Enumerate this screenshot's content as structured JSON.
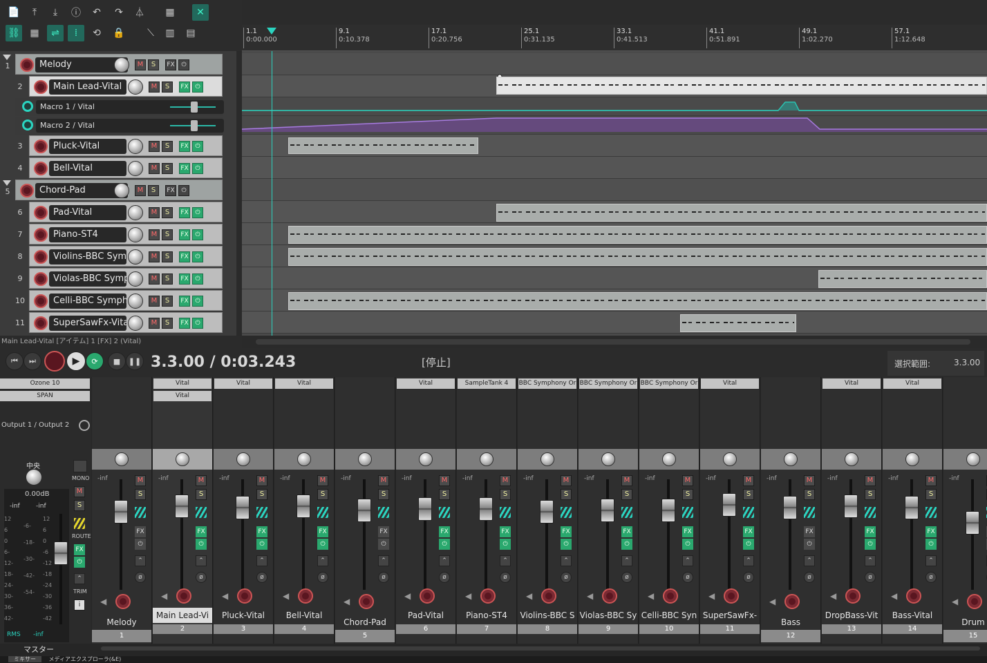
{
  "toolbar": {
    "row1_icons": [
      "new-file-icon",
      "open-icon",
      "save-icon",
      "info-icon",
      "undo-icon",
      "redo-icon",
      "metronome-icon",
      "grid-toggle-icon",
      "snap-icon"
    ],
    "row2_icons": [
      "link-icon",
      "grid-icon",
      "ripple-icon",
      "grid-lines-icon",
      "loop-icon",
      "lock-icon",
      "auto-crossfade-icon",
      "piano-icon",
      "piano-roll-icon"
    ]
  },
  "ruler": {
    "marks": [
      {
        "bar": "1.1",
        "time": "0:00.000"
      },
      {
        "bar": "9.1",
        "time": "0:10.378"
      },
      {
        "bar": "17.1",
        "time": "0:20.756"
      },
      {
        "bar": "25.1",
        "time": "0:31.135"
      },
      {
        "bar": "33.1",
        "time": "0:41.513"
      },
      {
        "bar": "41.1",
        "time": "0:51.891"
      },
      {
        "bar": "49.1",
        "time": "1:02.270"
      },
      {
        "bar": "57.1",
        "time": "1:12.648"
      }
    ]
  },
  "tracks": [
    {
      "num": "1",
      "name": "Melody",
      "folder": true,
      "fx": "FX"
    },
    {
      "num": "2",
      "name": "Main Lead-Vital",
      "selected": true,
      "fx": "FX"
    },
    {
      "num": "3",
      "name": "Pluck-Vital",
      "fx": "FX"
    },
    {
      "num": "4",
      "name": "Bell-Vital",
      "fx": "FX"
    },
    {
      "num": "5",
      "name": "Chord-Pad",
      "folder": true,
      "fx": "FX"
    },
    {
      "num": "6",
      "name": "Pad-Vital",
      "fx": "FX"
    },
    {
      "num": "7",
      "name": "Piano-ST4",
      "fx": "FX"
    },
    {
      "num": "8",
      "name": "Violins-BBC Symp",
      "fx": "FX"
    },
    {
      "num": "9",
      "name": "Violas-BBC Sympl",
      "fx": "FX"
    },
    {
      "num": "10",
      "name": "Celli-BBC Sympho",
      "fx": "FX"
    },
    {
      "num": "11",
      "name": "SuperSawFx-Vita",
      "fx": "FX"
    }
  ],
  "envelopes": [
    {
      "name": "Macro 1 / Vital"
    },
    {
      "name": "Macro 2 / Vital"
    }
  ],
  "labels": {
    "mute": "M",
    "solo": "S"
  },
  "status_line": "Main Lead-Vital [アイテム] 1 [FX] 2 (Vital)",
  "transport": {
    "time": "3.3.00 / 0:03.243",
    "state": "[停止]",
    "selection_label": "選択範囲:",
    "selection_value": "3.3.00"
  },
  "master": {
    "fx1": "Ozone 10",
    "fx2": "SPAN",
    "output": "Output 1 / Output 2",
    "pan_label": "中央",
    "db": "0.00dB",
    "inf_l": "-inf",
    "inf_r": "-inf",
    "scale_l": [
      "12",
      "6",
      "0",
      "6-",
      "12-",
      "18-",
      "24-",
      "30-",
      "36-",
      "42-"
    ],
    "scale_mid": [
      "-6-",
      "-18-",
      "-30-",
      "-42-",
      "-54-"
    ],
    "scale_r": [
      "12",
      "6",
      "0",
      "-6",
      "-12",
      "-18",
      "-24",
      "-30",
      "-36",
      "-42"
    ],
    "rms": "RMS",
    "rms_val": "-inf",
    "name": "マスター",
    "side_labels": {
      "mono": "MONO",
      "route": "ROUTE",
      "trim": "TRIM"
    }
  },
  "mixer_strips": [
    {
      "name": "Melody",
      "num": "1",
      "fx": [],
      "folder": true,
      "fxon": false
    },
    {
      "name": "Main Lead-Vi",
      "num": "2",
      "fx": [
        "Vital",
        "Vital"
      ],
      "selected": true,
      "fxon": true
    },
    {
      "name": "Pluck-Vital",
      "num": "3",
      "fx": [
        "Vital"
      ],
      "fxon": true
    },
    {
      "name": "Bell-Vital",
      "num": "4",
      "fx": [
        "Vital"
      ],
      "fxon": true
    },
    {
      "name": "Chord-Pad",
      "num": "5",
      "fx": [],
      "folder": true,
      "fxon": false
    },
    {
      "name": "Pad-Vital",
      "num": "6",
      "fx": [
        "Vital"
      ],
      "fxon": true
    },
    {
      "name": "Piano-ST4",
      "num": "7",
      "fx": [
        "SampleTank 4"
      ],
      "fxon": true
    },
    {
      "name": "Violins-BBC S",
      "num": "8",
      "fx": [
        "BBC Symphony Or"
      ],
      "fxon": true
    },
    {
      "name": "Violas-BBC Sy",
      "num": "9",
      "fx": [
        "BBC Symphony Or"
      ],
      "fxon": true
    },
    {
      "name": "Celli-BBC Syn",
      "num": "10",
      "fx": [
        "BBC Symphony Or"
      ],
      "fxon": true
    },
    {
      "name": "SuperSawFx-",
      "num": "11",
      "fx": [
        "Vital"
      ],
      "fxon": true
    },
    {
      "name": "Bass",
      "num": "12",
      "fx": [],
      "folder": true,
      "fxon": false
    },
    {
      "name": "DropBass-Vit",
      "num": "13",
      "fx": [
        "Vital"
      ],
      "fxon": true
    },
    {
      "name": "Bass-Vital",
      "num": "14",
      "fx": [
        "Vital"
      ],
      "fxon": true
    },
    {
      "name": "Drum",
      "num": "15",
      "fx": [],
      "folder": true,
      "fxon": false
    }
  ],
  "strip_inf": "-inf",
  "bottom_tabs": [
    "ミキサー",
    "メディアエクスプローラ(&E)"
  ],
  "colors": {
    "accent": "#2bd4c0",
    "fx_green": "#2aa86e",
    "arm_red": "#c55555",
    "env_purple": "#9b5fd0"
  }
}
